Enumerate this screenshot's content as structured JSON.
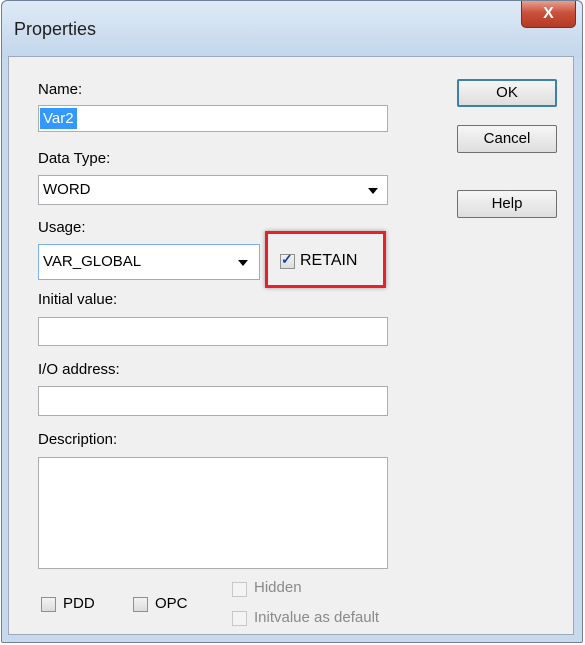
{
  "window": {
    "title": "Properties",
    "close_glyph": "X"
  },
  "form": {
    "name_label": "Name:",
    "name_value": "Var2",
    "datatype_label": "Data Type:",
    "datatype_value": "WORD",
    "usage_label": "Usage:",
    "usage_value": "VAR_GLOBAL",
    "retain_label": "RETAIN",
    "retain_checked": true,
    "initial_label": "Initial value:",
    "initial_value": "",
    "io_label": "I/O address:",
    "io_value": "",
    "description_label": "Description:",
    "description_value": ""
  },
  "buttons": {
    "ok": "OK",
    "cancel": "Cancel",
    "help": "Help"
  },
  "options": {
    "pdd": "PDD",
    "opc": "OPC",
    "hidden": "Hidden",
    "initvalue_default": "Initvalue as default"
  },
  "colors": {
    "highlight": "#e8202a",
    "selection": "#3399ff",
    "close_button": "#c9503b"
  }
}
